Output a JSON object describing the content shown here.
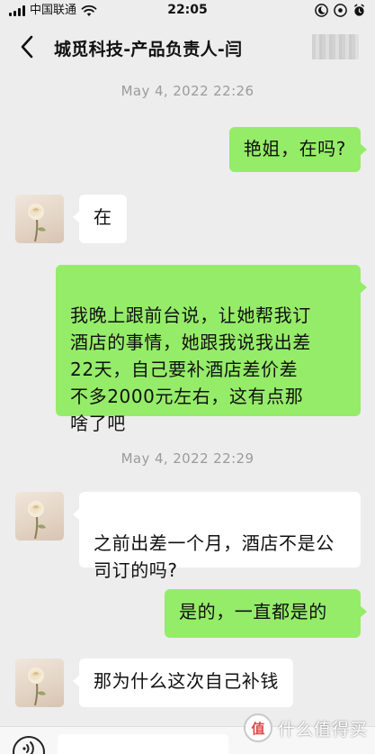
{
  "status_bar": {
    "carrier": "中国联通",
    "time": "22:05"
  },
  "nav": {
    "back_icon": "chevron-left-icon",
    "title": "城觅科技-产品负责人-闫"
  },
  "messages": [
    {
      "type": "timestamp",
      "text": "May 4, 2022 22:26"
    },
    {
      "type": "sent",
      "text": "艳姐，在吗?"
    },
    {
      "type": "received",
      "text": "在"
    },
    {
      "type": "sent",
      "text": "我晚上跟前台说，让她帮我订\n酒店的事情，她跟我说我出差\n22天，自己要补酒店差价差\n不多2000元左右，这有点那\n啥了吧"
    },
    {
      "type": "timestamp",
      "text": "May 4, 2022 22:29"
    },
    {
      "type": "received",
      "text": "之前出差一个月，酒店不是公\n司订的吗?"
    },
    {
      "type": "sent",
      "text": "是的，一直都是的"
    },
    {
      "type": "received",
      "text": "那为什么这次自己补钱"
    }
  ],
  "input_bar": {
    "voice_icon": "voice-icon",
    "message_value": ""
  },
  "watermark": {
    "logo": "值",
    "text": "什么值得买"
  },
  "colors": {
    "background": "#ededed",
    "sent_bubble": "#95ec69",
    "received_bubble": "#ffffff",
    "timestamp": "#9b9b9b"
  }
}
